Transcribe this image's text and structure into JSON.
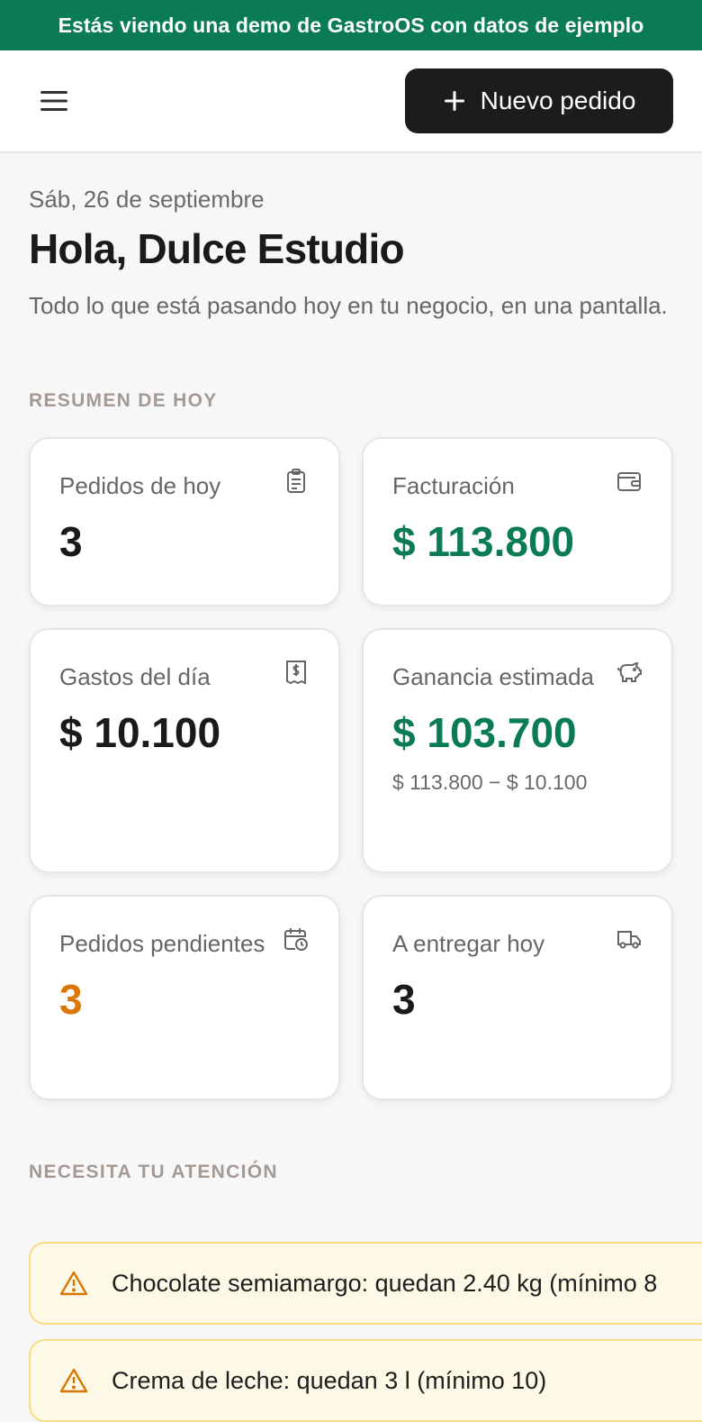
{
  "banner": {
    "text": "Estás viendo una demo de GastroOS con datos de ejemplo"
  },
  "header": {
    "new_order_label": "Nuevo pedido",
    "menu_icon": "menu-icon",
    "plus_icon": "plus-icon"
  },
  "page": {
    "date": "Sáb, 26 de septiembre",
    "greeting": "Hola, Dulce Estudio",
    "subtitle": "Todo lo que está pasando hoy en tu negocio, en una pantalla."
  },
  "summary": {
    "label": "RESUMEN DE HOY",
    "cards": [
      {
        "title": "Pedidos de hoy",
        "value": "3",
        "icon": "clipboard-icon"
      },
      {
        "title": "Facturación",
        "value": "$ 113.800",
        "icon": "wallet-icon",
        "color": "#0b7a57"
      },
      {
        "title": "Gastos del día",
        "value": "$ 10.100",
        "icon": "receipt-icon"
      },
      {
        "title": "Ganancia estimada",
        "value": "$ 103.700",
        "note": "$ 113.800 − $ 10.100",
        "icon": "piggy-bank-icon",
        "color": "#0b7a57"
      },
      {
        "title": "Pedidos pendientes",
        "value": "3",
        "icon": "calendar-clock-icon",
        "color": "#d97706"
      },
      {
        "title": "A entregar hoy",
        "value": "3",
        "icon": "truck-icon"
      }
    ]
  },
  "attention": {
    "label": "NECESITA TU ATENCIÓN",
    "alerts": [
      {
        "text": "Chocolate semiamargo: quedan 2.40 kg (mínimo 8",
        "icon": "warning-icon"
      },
      {
        "text": "Crema de leche: quedan 3 l (mínimo 10)",
        "icon": "warning-icon"
      }
    ]
  },
  "colors": {
    "brand": "#0b7a57",
    "pending": "#d97706",
    "alert_bg": "#fef9e6",
    "alert_border": "#f7dd88"
  }
}
